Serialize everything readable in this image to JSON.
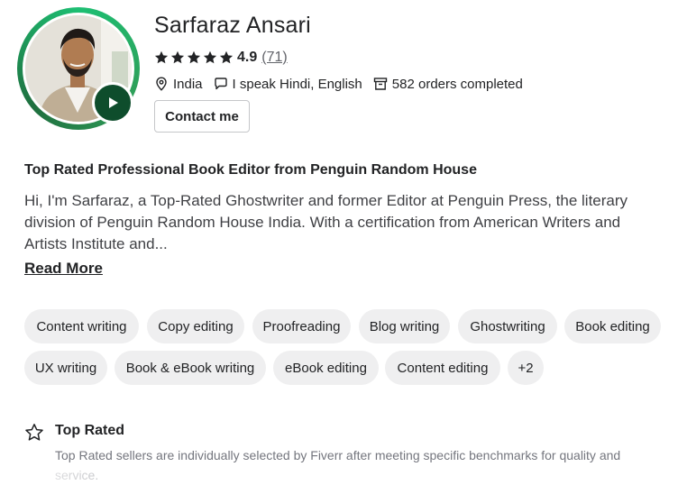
{
  "profile": {
    "name": "Sarfaraz Ansari",
    "rating": "4.9",
    "review_count": "(71)",
    "stars": 5,
    "country": "India",
    "languages": "I speak Hindi, English",
    "orders": "582 orders completed",
    "contact_label": "Contact me"
  },
  "about": {
    "headline": "Top Rated Professional Book Editor from Penguin Random House",
    "bio": "Hi, I'm Sarfaraz, a Top-Rated Ghostwriter and former Editor at Penguin Press, the literary division of Penguin Random House India. With a certification from American Writers and Artists Institute and...",
    "read_more": "Read More"
  },
  "skills": [
    "Content writing",
    "Copy editing",
    "Proofreading",
    "Blog writing",
    "Ghostwriting",
    "Book editing",
    "UX writing",
    "Book & eBook writing",
    "eBook editing",
    "Content editing",
    "+2"
  ],
  "badge": {
    "title": "Top Rated",
    "description": "Top Rated sellers are individually selected by Fiverr after meeting specific benchmarks for quality and service."
  },
  "icons": {
    "play": "play-icon",
    "star": "star-icon",
    "location": "location-pin-icon",
    "language": "speech-bubble-icon",
    "orders": "archive-box-icon",
    "top_rated": "star-outline-icon"
  },
  "colors": {
    "ring": "#1dbf73",
    "play_bg": "#0e4d2c",
    "chip_bg": "#efeff0",
    "text": "#222325",
    "muted": "#74767e"
  }
}
